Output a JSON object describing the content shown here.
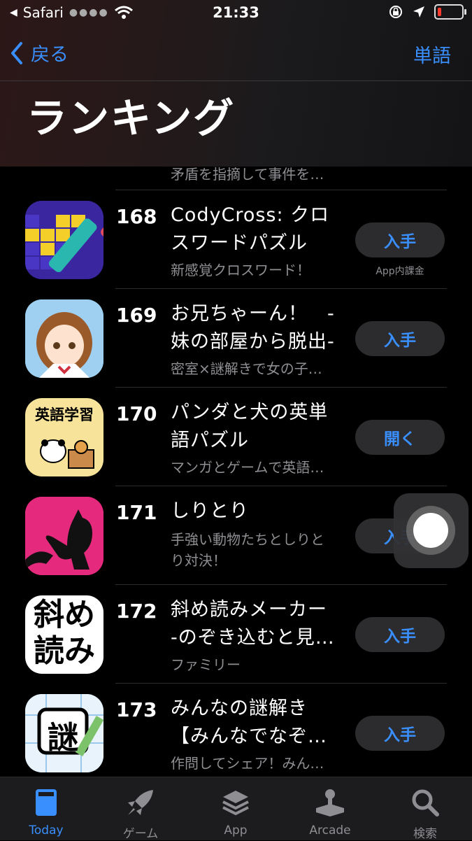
{
  "status_bar": {
    "carrier": "Safari",
    "time": "21:33"
  },
  "nav": {
    "back_label": "戻る",
    "right_label": "単語"
  },
  "page_title": "ランキング",
  "rows": [
    {
      "rank": "",
      "title": "",
      "subtitle": "矛盾を指摘して事件を…",
      "button": "",
      "iap": ""
    },
    {
      "rank": "168",
      "title": "CodyCross: クロ\nスワードパズル",
      "subtitle": "新感覚クロスワード！",
      "button": "入手",
      "iap": "App内課金"
    },
    {
      "rank": "169",
      "title": "お兄ちゃーん！　-\n妹の部屋から脱出-",
      "subtitle": "密室×謎解きで女の子…",
      "button": "入手",
      "iap": ""
    },
    {
      "rank": "170",
      "title": "パンダと犬の英単\n語パズル",
      "subtitle": "マンガとゲームで英語…",
      "button": "開く",
      "iap": "",
      "icon_text": "英語学習"
    },
    {
      "rank": "171",
      "title": "しりとり",
      "subtitle": "手強い動物たちとしりと\nり対決！",
      "button": "入手",
      "iap": ""
    },
    {
      "rank": "172",
      "title": "斜め読みメーカー\n-のぞき込むと見…",
      "subtitle": "ファミリー",
      "button": "入手",
      "iap": "",
      "icon_text": "斜め\n読み"
    },
    {
      "rank": "173",
      "title": "みんなの謎解き\n【みんなでなぞ…",
      "subtitle": "作問してシェア！みん…",
      "button": "入手",
      "iap": "",
      "icon_text": "謎"
    }
  ],
  "tabs": [
    {
      "label": "Today",
      "icon": "today-icon",
      "active": true
    },
    {
      "label": "ゲーム",
      "icon": "rocket-icon"
    },
    {
      "label": "App",
      "icon": "layers-icon"
    },
    {
      "label": "Arcade",
      "icon": "joystick-icon"
    },
    {
      "label": "検索",
      "icon": "search-icon"
    }
  ],
  "colors": {
    "accent": "#3a8fff",
    "secondary_text": "#8e8e93",
    "button_bg": "#2c2c2e"
  }
}
